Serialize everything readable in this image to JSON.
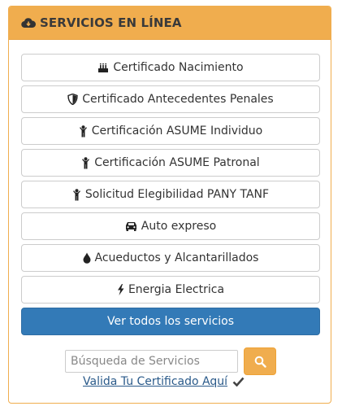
{
  "panel": {
    "title": "SERVICIOS EN LÍNEA",
    "title_icon": "cloud-download-icon"
  },
  "services": [
    {
      "label": "Certificado Nacimiento",
      "icon": "birthday-cake-icon"
    },
    {
      "label": "Certificado Antecedentes Penales",
      "icon": "shield-icon"
    },
    {
      "label": "Certificación ASUME Individuo",
      "icon": "child-icon"
    },
    {
      "label": "Certificación ASUME Patronal",
      "icon": "child-icon"
    },
    {
      "label": "Solicitud Elegibilidad PANY TANF",
      "icon": "child-icon"
    },
    {
      "label": "Auto expreso",
      "icon": "car-icon"
    },
    {
      "label": "Acueductos y Alcantarillados",
      "icon": "tint-icon"
    },
    {
      "label": "Energia Electrica",
      "icon": "bolt-icon"
    }
  ],
  "all_services_label": "Ver todos los servicios",
  "search": {
    "placeholder": "Búsqueda de Servicios",
    "value": "",
    "button_icon": "search-icon"
  },
  "validate": {
    "label": "Valida Tu Certificado Aquí",
    "icon": "check-icon"
  },
  "colors": {
    "accent": "#f0ad4e",
    "primary": "#337ab7",
    "link": "#2a5a8a"
  }
}
